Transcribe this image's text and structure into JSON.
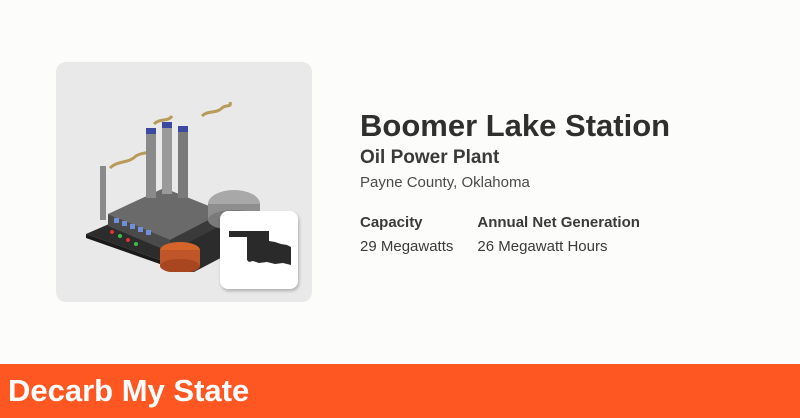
{
  "plant": {
    "name": "Boomer Lake Station",
    "type": "Oil Power Plant",
    "location": "Payne County, Oklahoma",
    "image_icon": "oil-power-plant-illustration",
    "state_icon": "oklahoma-state-silhouette-icon"
  },
  "stats": {
    "capacity_label": "Capacity",
    "capacity_value": "29 Megawatts",
    "generation_label": "Annual Net Generation",
    "generation_value": "26 Megawatt Hours"
  },
  "footer": {
    "title": "Decarb My State"
  },
  "colors": {
    "accent": "#ff5722",
    "text": "#2f2f2f",
    "background": "#fcfcfa",
    "image_bg": "#e9e9e9"
  }
}
